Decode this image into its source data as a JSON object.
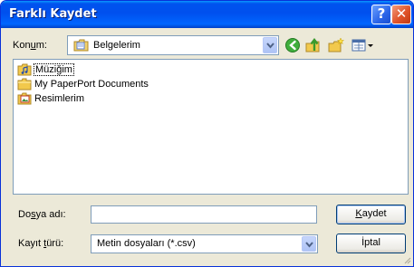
{
  "window": {
    "title": "Farklı Kaydet"
  },
  "lookin": {
    "label_pre": "Kon",
    "label_accel": "u",
    "label_post": "m:",
    "value": "Belgelerim"
  },
  "files": [
    {
      "name": "Müziğim",
      "icon": "music-folder-icon"
    },
    {
      "name": "My PaperPort Documents",
      "icon": "folder-icon"
    },
    {
      "name": "Resimlerim",
      "icon": "pictures-folder-icon"
    }
  ],
  "filename": {
    "label_pre": "Do",
    "label_accel": "s",
    "label_post": "ya adı:",
    "value": ""
  },
  "filetype": {
    "label_pre": "Kayıt ",
    "label_accel": "t",
    "label_post": "ürü:",
    "value": "Metin dosyaları  (*.csv)"
  },
  "buttons": {
    "save_accel": "K",
    "save_rest": "aydet",
    "cancel": "İptal"
  },
  "toolbar": {
    "back": "back-icon",
    "up": "up-folder-icon",
    "new_folder": "new-folder-icon",
    "views": "views-menu-icon"
  }
}
